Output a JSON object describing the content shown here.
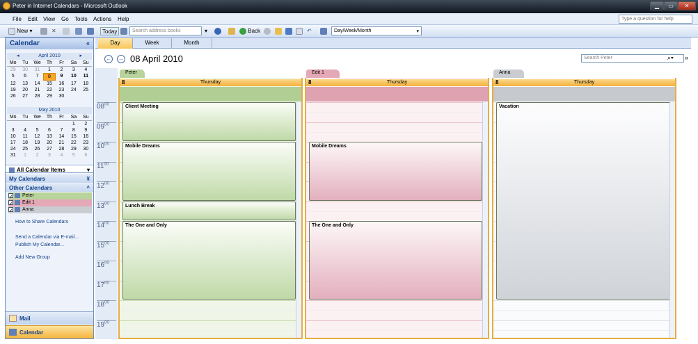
{
  "window": {
    "title": "Peter in Internet Calendars - Microsoft Outlook"
  },
  "menu": [
    "File",
    "Edit",
    "View",
    "Go",
    "Tools",
    "Actions",
    "Help"
  ],
  "ask_placeholder": "Type a question for help",
  "toolbar": {
    "new_label": "New",
    "today_label": "Today",
    "address_placeholder": "Search address books",
    "back_label": "Back",
    "view_select": "Day/Week/Month"
  },
  "nav": {
    "title": "Calendar",
    "collapse_glyph": "«",
    "mini_calendars": [
      {
        "month": "April 2010",
        "weekdays": [
          "Mo",
          "Tu",
          "We",
          "Th",
          "Fr",
          "Sa",
          "Su"
        ],
        "weeks": [
          [
            "29",
            "30",
            "31",
            "1",
            "2",
            "3",
            "4"
          ],
          [
            "5",
            "6",
            "7",
            "8",
            "9",
            "10",
            "11"
          ],
          [
            "12",
            "13",
            "14",
            "15",
            "16",
            "17",
            "18"
          ],
          [
            "19",
            "20",
            "21",
            "22",
            "23",
            "24",
            "25"
          ],
          [
            "26",
            "27",
            "28",
            "29",
            "30",
            "",
            ""
          ]
        ]
      },
      {
        "month": "May 2010",
        "weekdays": [
          "Mo",
          "Tu",
          "We",
          "Th",
          "Fr",
          "Sa",
          "Su"
        ],
        "weeks": [
          [
            "",
            "",
            "",
            "",
            "",
            "1",
            "2"
          ],
          [
            "3",
            "4",
            "5",
            "6",
            "7",
            "8",
            "9"
          ],
          [
            "10",
            "11",
            "12",
            "13",
            "14",
            "15",
            "16"
          ],
          [
            "17",
            "18",
            "19",
            "20",
            "21",
            "22",
            "23"
          ],
          [
            "24",
            "25",
            "26",
            "27",
            "28",
            "29",
            "30"
          ],
          [
            "31",
            "1",
            "2",
            "3",
            "4",
            "5",
            "6"
          ]
        ]
      }
    ],
    "all_items": "All Calendar Items",
    "my_calendars": "My Calendars",
    "other_calendars": "Other Calendars",
    "calendars": [
      {
        "name": "Peter",
        "color": "#b9d39c"
      },
      {
        "name": "Edit 1",
        "color": "#e5a8b6"
      },
      {
        "name": "Anna",
        "color": "#c9ccd1"
      }
    ],
    "links": [
      "How to Share Calendars",
      "Send a Calendar via E-mail...",
      "Publish My Calendar...",
      "Add New Group"
    ],
    "buttons": [
      "Mail",
      "Calendar"
    ]
  },
  "view_tabs": [
    "Day",
    "Week",
    "Month"
  ],
  "date_label": "08 April 2010",
  "search_placeholder": "Search Peter",
  "hours": [
    "08",
    "09",
    "10",
    "11",
    "12",
    "13",
    "14",
    "15",
    "16",
    "17",
    "18",
    "19"
  ],
  "hour_suffix": "00",
  "day_number": "8",
  "weekday": "Thursday",
  "columns": [
    {
      "name": "Peter",
      "tab_color": "#b9d39c",
      "body": "#eff6e7",
      "line": "#c9dcb3",
      "allday": "#b1cf95",
      "appointments": [
        {
          "title": "Client Meeting",
          "start": 8,
          "end": 10
        },
        {
          "title": "Mobile Dreams",
          "start": 10,
          "end": 13
        },
        {
          "title": "Lunch Break",
          "start": 13,
          "end": 14
        },
        {
          "title": "The One and Only",
          "start": 14,
          "end": 18
        }
      ]
    },
    {
      "name": "Edit 1",
      "tab_color": "#e5a8b6",
      "body": "#fbf0f2",
      "line": "#e8c3cb",
      "allday": "#dea2b0",
      "appointments": [
        {
          "title": "Mobile Dreams",
          "start": 10,
          "end": 13
        },
        {
          "title": "The One and Only",
          "start": 14,
          "end": 18
        }
      ]
    },
    {
      "name": "Anna",
      "tab_color": "#c9ccd1",
      "body": "#fafbfc",
      "line": "#dfe2e6",
      "allday": "#c6c9ce",
      "appointments": [
        {
          "title": "Vacation",
          "start": 8,
          "end": 18
        }
      ]
    }
  ]
}
